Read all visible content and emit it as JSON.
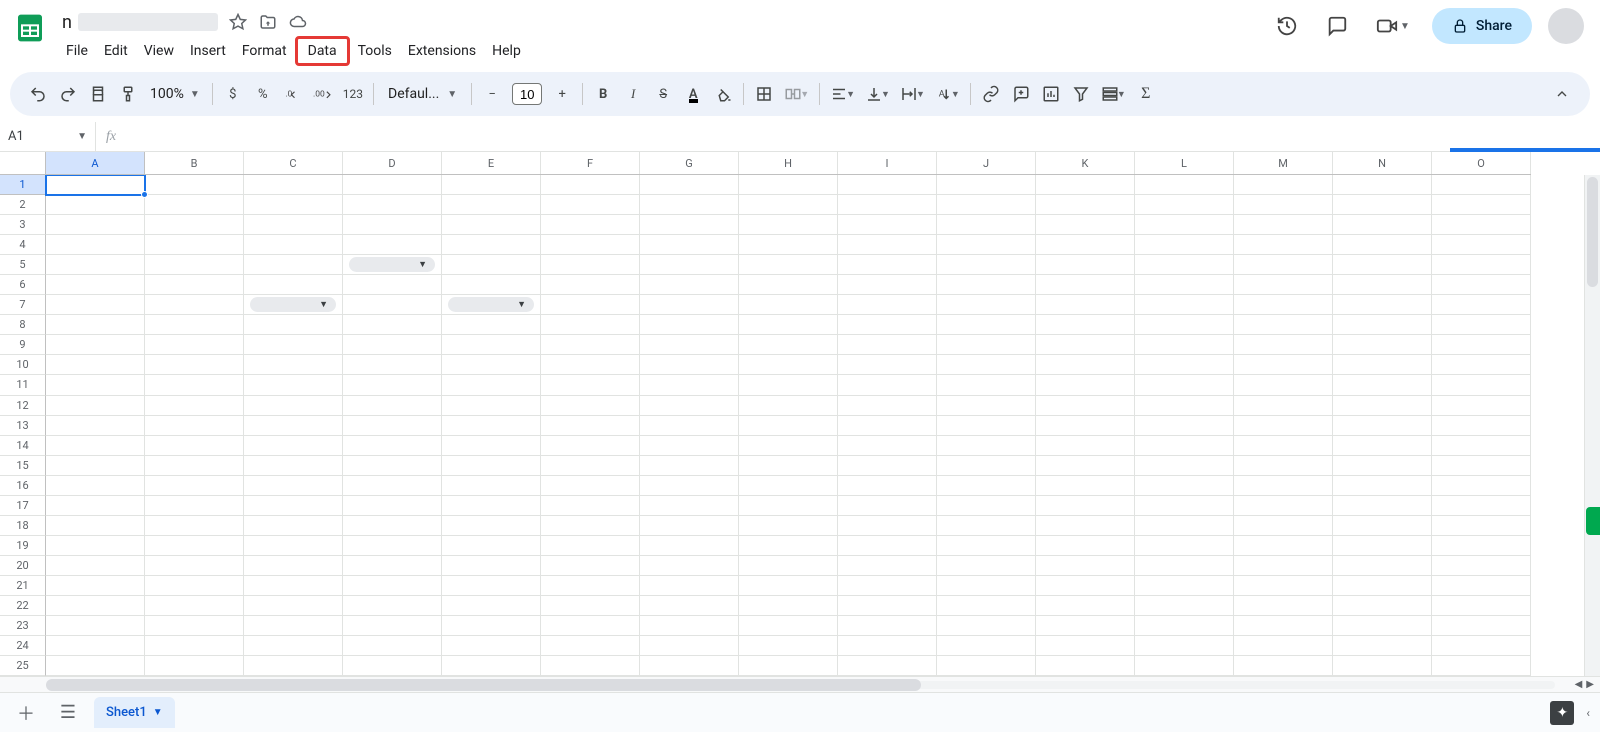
{
  "doc": {
    "title_prefix": "n"
  },
  "menus": {
    "file": "File",
    "edit": "Edit",
    "view": "View",
    "insert": "Insert",
    "format": "Format",
    "data": "Data",
    "tools": "Tools",
    "extensions": "Extensions",
    "help": "Help",
    "highlighted": "data"
  },
  "header": {
    "share": "Share"
  },
  "toolbar": {
    "zoom": "100%",
    "currency": "$",
    "percent": "%",
    "dec_dec": ".0",
    "inc_dec": ".00",
    "numfmt": "123",
    "font": "Defaul...",
    "fontsize": "10"
  },
  "namebox": {
    "ref": "A1"
  },
  "fx": {
    "label": "fx"
  },
  "columns": [
    "A",
    "B",
    "C",
    "D",
    "E",
    "F",
    "G",
    "H",
    "I",
    "J",
    "K",
    "L",
    "M",
    "N",
    "O"
  ],
  "rows": 25,
  "selected": {
    "col": "A",
    "row": 1
  },
  "chips": [
    {
      "row": 5,
      "col": "D"
    },
    {
      "row": 7,
      "col": "C"
    },
    {
      "row": 7,
      "col": "E"
    }
  ],
  "sheet": {
    "name": "Sheet1"
  }
}
